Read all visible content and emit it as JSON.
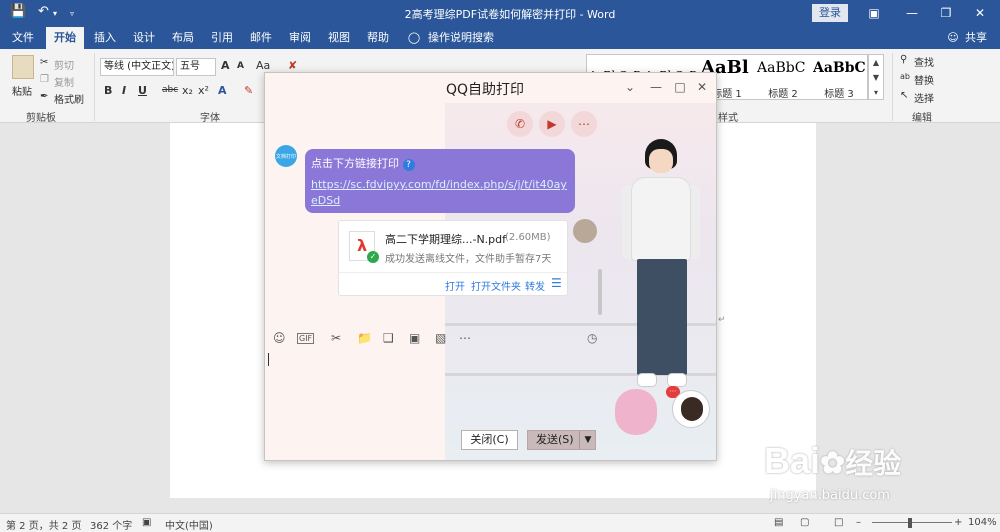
{
  "titlebar": {
    "doc_title": "2高考理综PDF试卷如何解密并打印 - Word",
    "login": "登录",
    "save_icon": "save-icon",
    "undo_icon": "undo-icon"
  },
  "tabs": [
    "文件",
    "开始",
    "插入",
    "设计",
    "布局",
    "引用",
    "邮件",
    "审阅",
    "视图",
    "帮助",
    "操作说明搜索"
  ],
  "share": "共享",
  "ribbon": {
    "clipboard": {
      "paste": "粘贴",
      "cut": "剪切",
      "copy": "复制",
      "format_painter": "格式刷",
      "label": "剪贴板"
    },
    "font": {
      "family": "等线 (中文正文)",
      "size": "五号",
      "label": "字体",
      "grow": "A",
      "shrink": "A",
      "case": "Aa"
    },
    "styles": {
      "items": [
        {
          "sample": "AaBbCcDd",
          "name": ""
        },
        {
          "sample": "AaBbCcDd",
          "name": ""
        },
        {
          "sample": "AaBl",
          "name": "标题 1"
        },
        {
          "sample": "AaBbC",
          "name": "标题 2"
        },
        {
          "sample": "AaBbC",
          "name": "标题 3"
        }
      ],
      "label": "样式"
    },
    "editing": {
      "find": "查找",
      "replace": "替换",
      "select": "选择",
      "label": "编辑"
    }
  },
  "qq": {
    "title": "QQ自助打印",
    "bot_avatar_text": "文档打印",
    "message": "点击下方链接打印",
    "link": "https://sc.fdvipyy.com/fd/index.php/s/j/t/it40ayeDSd",
    "file": {
      "name": "高二下学期理综...-N.pdf",
      "size": "(2.60MB)",
      "status": "成功发送离线文件，文件助手暂存7天",
      "open": "打开",
      "open_folder": "打开文件夹",
      "forward": "转发"
    },
    "close_button": "关闭(C)",
    "send_button": "发送(S)"
  },
  "statusbar": {
    "page": "第 2 页，共 2 页",
    "words": "362 个字",
    "language": "中文(中国)",
    "zoom": "104%"
  },
  "watermark": {
    "text": "Bai 经验",
    "url": "jingyan.baidu.com"
  }
}
